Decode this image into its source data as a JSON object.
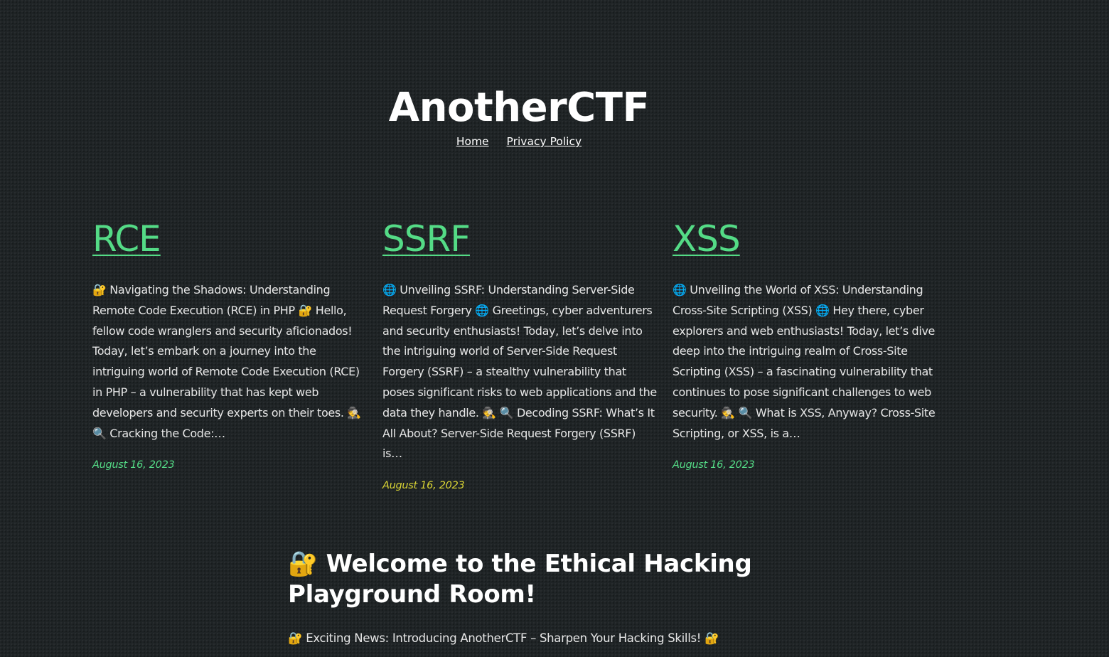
{
  "site": {
    "title": "AnotherCTF"
  },
  "nav": {
    "items": [
      {
        "label": "Home"
      },
      {
        "label": "Privacy Policy"
      }
    ]
  },
  "posts": [
    {
      "title": "RCE",
      "excerpt": "🔐 Navigating the Shadows: Understanding Remote Code Execution (RCE) in PHP 🔐 Hello, fellow code wranglers and security aficionados! Today, let’s embark on a journey into the intriguing world of Remote Code Execution (RCE) in PHP – a vulnerability that has kept web developers and security experts on their toes. 🕵️ 🔍 Cracking the Code:…",
      "date": "August 16, 2023",
      "date_color": "#54db86"
    },
    {
      "title": "SSRF",
      "excerpt": "🌐 Unveiling SSRF: Understanding Server-Side Request Forgery 🌐 Greetings, cyber adventurers and security enthusiasts! Today, let’s delve into the intriguing world of Server-Side Request Forgery (SSRF) – a stealthy vulnerability that poses significant risks to web applications and the data they handle. 🕵️ 🔍 Decoding SSRF: What’s It All About? Server-Side Request Forgery (SSRF) is…",
      "date": "August 16, 2023",
      "date_color": "#d8d334"
    },
    {
      "title": "XSS",
      "excerpt": "🌐 Unveiling the World of XSS: Understanding Cross-Site Scripting (XSS) 🌐 Hey there, cyber explorers and web enthusiasts! Today, let’s dive deep into the intriguing realm of Cross-Site Scripting (XSS) – a fascinating vulnerability that continues to pose significant challenges to web security. 🕵️ 🔍 What is XSS, Anyway? Cross-Site Scripting, or XSS, is a…",
      "date": "August 16, 2023",
      "date_color": "#54db86"
    }
  ],
  "welcome": {
    "title": "🔐 Welcome to the Ethical Hacking Playground Room!",
    "subtitle": "🔐 Exciting News: Introducing AnotherCTF – Sharpen Your Hacking Skills! 🔐"
  },
  "colors": {
    "background": "#1f2426",
    "accent": "#54db86",
    "accent_alt": "#d8d334",
    "text": "#e6e6e6"
  }
}
